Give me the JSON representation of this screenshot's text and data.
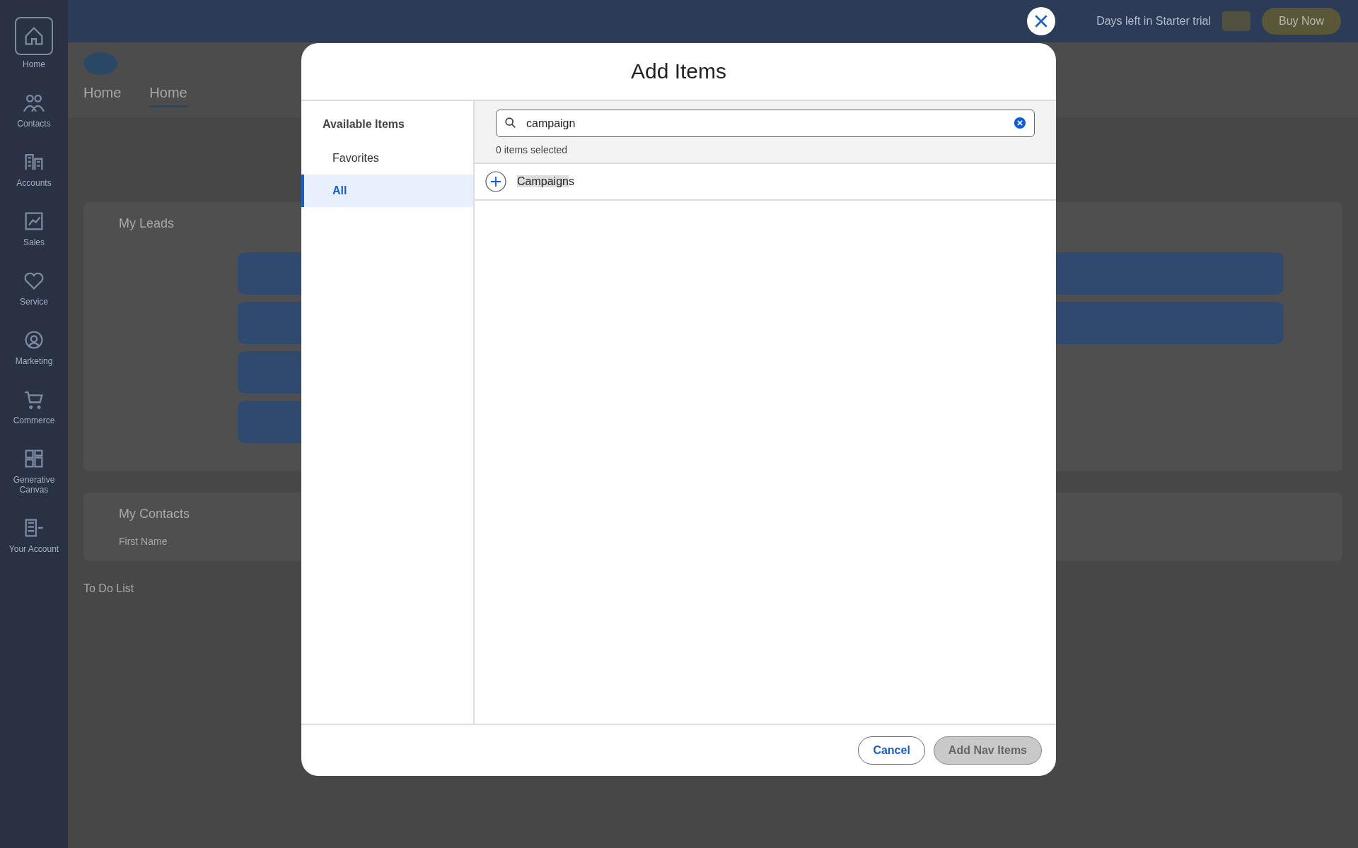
{
  "background": {
    "top_bar": {
      "trial_text": "Days left in Starter trial",
      "buy_button": "Buy Now"
    },
    "sidebar": [
      {
        "label": "Home",
        "kind": "home",
        "selected": true
      },
      {
        "label": "Contacts",
        "kind": "contacts",
        "selected": false
      },
      {
        "label": "Accounts",
        "kind": "accounts",
        "selected": false
      },
      {
        "label": "Sales",
        "kind": "sales",
        "selected": false
      },
      {
        "label": "Service",
        "kind": "service",
        "selected": false
      },
      {
        "label": "Marketing",
        "kind": "marketing",
        "selected": false
      },
      {
        "label": "Commerce",
        "kind": "commerce",
        "selected": false
      },
      {
        "label": "Generative Canvas",
        "kind": "canvas",
        "selected": false
      },
      {
        "label": "Your Account",
        "kind": "account",
        "selected": false
      }
    ],
    "tabs": [
      {
        "label": "Home",
        "selected": false
      },
      {
        "label": "Home",
        "selected": true
      }
    ],
    "leads_card": {
      "title": "My Leads"
    },
    "contacts_card": {
      "title": "My Contacts",
      "column": "First Name"
    },
    "footer": {
      "label": "To Do List"
    }
  },
  "dialog": {
    "title": "Add Items",
    "categories_heading": "Available Items",
    "categories": [
      {
        "label": "Favorites",
        "selected": false
      },
      {
        "label": "All",
        "selected": true
      }
    ],
    "search": {
      "value": "campaign"
    },
    "selection_count": "0 items selected",
    "results": [
      {
        "matched": "Campaign",
        "rest": "s"
      }
    ],
    "buttons": [
      {
        "label": "Cancel",
        "kind": "neutral",
        "disabled": false
      },
      {
        "label": "Add Nav Items",
        "kind": "brand",
        "disabled": true
      }
    ]
  }
}
